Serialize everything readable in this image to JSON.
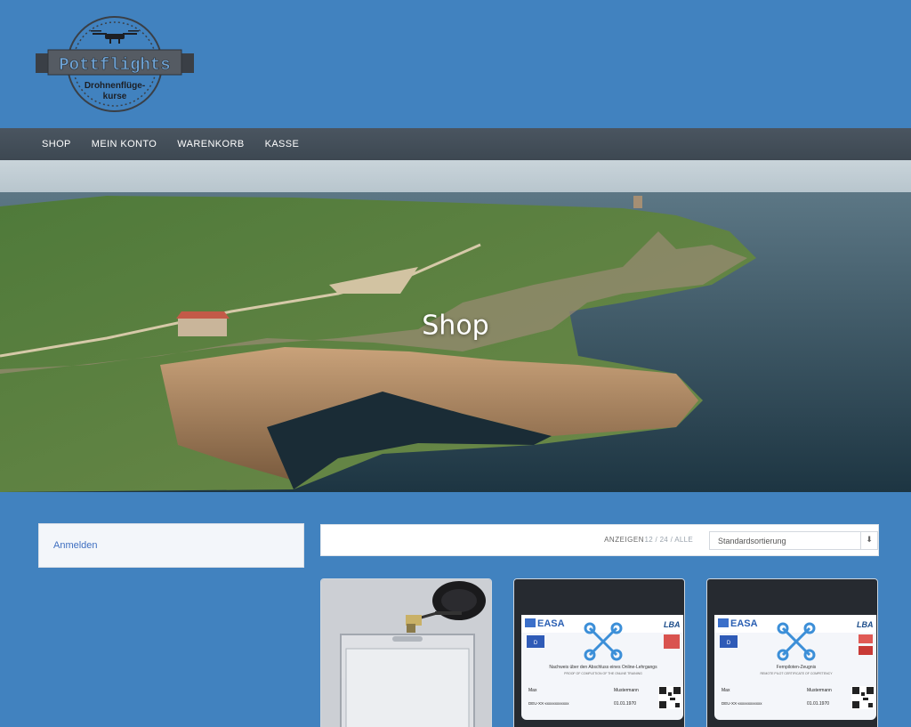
{
  "logo": {
    "brand": "Pottflights",
    "tagline_line1": "Drohnenflüge-",
    "tagline_line2": "kurse"
  },
  "nav": {
    "items": [
      {
        "label": "SHOP"
      },
      {
        "label": "MEIN KONTO"
      },
      {
        "label": "WARENKORB"
      },
      {
        "label": "KASSE"
      }
    ]
  },
  "hero": {
    "title": "Shop"
  },
  "sidebar": {
    "login_link": "Anmelden"
  },
  "toolbar": {
    "show_label": "ANZEIGEN",
    "show_options": [
      "12",
      "24",
      "ALLE"
    ],
    "separator": "/",
    "sort_value": "Standardsortierung"
  },
  "products": [
    {
      "image": "badge-holder-photo"
    },
    {
      "image": "easa-card-photo",
      "card_brand": "EASA",
      "card_authority": "LBA",
      "card_country": "D",
      "card_title": "Nachweis über den Abschluss eines Online-Lehrgangs",
      "card_subtitle": "PROOF OF COMPLETION OF THE ONLINE TRAINING",
      "first_name": "Max",
      "last_name": "Mustermann",
      "id_number": "DEU-XX-xxxxxxxxxxxx",
      "date": "01.01.1970"
    },
    {
      "image": "easa-card-photo",
      "card_brand": "EASA",
      "card_authority": "LBA",
      "card_country": "D",
      "card_title": "Fernpiloten-Zeugnis",
      "card_subtitle": "REMOTE PILOT CERTIFICATE OF COMPETENCY",
      "first_name": "Max",
      "last_name": "Mustermann",
      "id_number": "DEU-XX-xxxxxxxxxxxx",
      "date": "01.01.1970"
    }
  ],
  "colors": {
    "page_bg": "#4182bf",
    "nav_bg": "#434e59",
    "link": "#3f6fc0"
  }
}
